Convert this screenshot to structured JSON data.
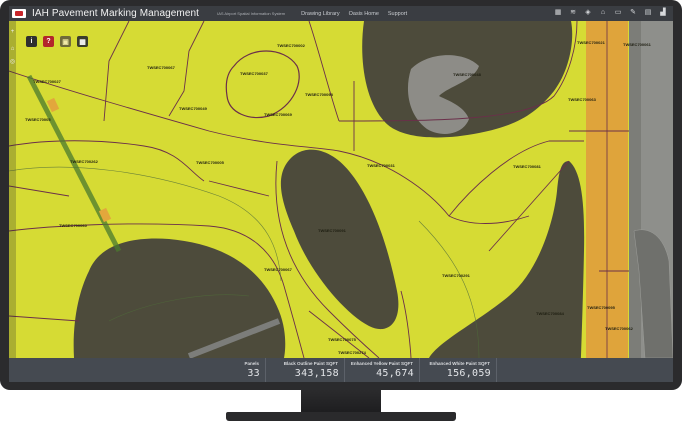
{
  "app": {
    "title": "IAH Pavement Marking Management",
    "subtitle": "IAS Airport Spatial Information System"
  },
  "nav": [
    "Drawing Library",
    "Oasis Home",
    "Support"
  ],
  "toolbar_icons": [
    "grid-icon",
    "layers-icon",
    "basemap-icon",
    "bookmark-icon",
    "measure-icon",
    "draw-icon",
    "print-icon",
    "chart-icon"
  ],
  "map_labels": [
    "TWSEC700027",
    "TWSEC70005",
    "TWSEC700067",
    "TWSEC700002",
    "TWSEC700037",
    "TWSEC700049",
    "TWSEC700262",
    "TWSEC700060",
    "TWSEC700098",
    "TWSEC700005",
    "TWSEC700031",
    "TWSEC700048",
    "TWSEC700021",
    "TWSEC700061",
    "TWSEC700063",
    "TWSEC700081",
    "TWSEC700091",
    "TWSEC700067",
    "TWSEC700069",
    "TWSEC700291",
    "TWSEC700075",
    "TWSEC700274",
    "TWSEC700084",
    "TWSEC700095",
    "TWSEC700062"
  ],
  "stats": [
    {
      "label": "Panels",
      "value": "33"
    },
    {
      "label": "Black Outline Paint SQFT",
      "value": "343,158"
    },
    {
      "label": "Enhanced Yellow Paint SQFT",
      "value": "45,674"
    },
    {
      "label": "Enhanced White Paint SQFT",
      "value": "156,059"
    }
  ],
  "colors": {
    "panel_fill": "#d8dd36",
    "panel_outline": "#6b2f4a",
    "orange_panel": "#e0a43a",
    "grass": "#4e4c3c",
    "titlebar": "#3a3d42",
    "statsbar": "#454a51"
  }
}
